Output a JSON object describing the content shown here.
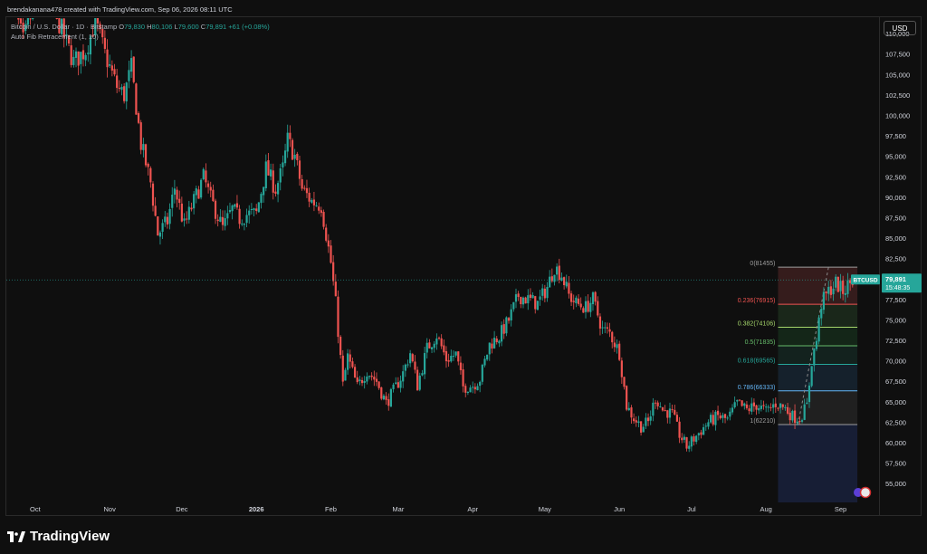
{
  "header": {
    "creator_line": "brendakanana478 created with TradingView.com, Sep 06, 2026 08:11 UTC"
  },
  "legend": {
    "symbol_line": "Bitcoin / U.S. Dollar · 1D · Bitstamp",
    "open_label": "O",
    "open_value": "79,830",
    "high_label": "H",
    "high_value": "80,106",
    "low_label": "L",
    "low_value": "79,600",
    "close_label": "C",
    "close_value": "79,891",
    "change_value": "+61 (+0.08%)",
    "indicator_line": "Auto Fib Retracement (1, 10)"
  },
  "price_axis": {
    "currency": "USD",
    "last_price_symbol": "BTCUSD",
    "last_price": "79,891",
    "countdown": "15:48:35"
  },
  "brand": {
    "name": "TradingView",
    "logo_icon": "tradingview-logo-icon"
  },
  "colors": {
    "up": "#26a69a",
    "down": "#ef5350",
    "background": "#0f0f0f"
  },
  "chart_data": {
    "type": "candlestick",
    "symbol": "BTCUSD",
    "exchange": "Bitstamp",
    "interval": "1D",
    "y_axis": {
      "min": 52700,
      "max": 112000,
      "ticks": [
        55000,
        57500,
        60000,
        62500,
        65000,
        67500,
        70000,
        72500,
        75000,
        77500,
        80000,
        82500,
        85000,
        87500,
        90000,
        92500,
        95000,
        97500,
        100000,
        102500,
        105000,
        107500,
        110000
      ],
      "tick_labels": [
        "55,000",
        "57,500",
        "60,000",
        "62,500",
        "65,000",
        "67,500",
        "70,000",
        "72,500",
        "75,000",
        "77,500",
        "80,000",
        "82,500",
        "85,000",
        "87,500",
        "90,000",
        "92,500",
        "95,000",
        "97,500",
        "100,000",
        "102,500",
        "105,000",
        "107,500",
        "110,000"
      ]
    },
    "x_axis": {
      "labels": [
        "Oct",
        "Nov",
        "Dec",
        "2026",
        "Feb",
        "Mar",
        "Apr",
        "May",
        "Jun",
        "Jul",
        "Aug",
        "Sep"
      ],
      "label_dates": [
        "2025-10-01",
        "2025-11-01",
        "2025-12-01",
        "2026-01-01",
        "2026-02-01",
        "2026-03-01",
        "2026-04-01",
        "2026-05-01",
        "2026-06-01",
        "2026-07-01",
        "2026-08-01",
        "2026-09-01"
      ],
      "start_date": "2025-09-19",
      "end_date": "2026-09-17"
    },
    "closes_path": [
      [
        "2025-09-20",
        115500
      ],
      [
        "2025-09-26",
        109000
      ],
      [
        "2025-10-01",
        114000
      ],
      [
        "2025-10-06",
        124000
      ],
      [
        "2025-10-10",
        112000
      ],
      [
        "2025-10-17",
        106500
      ],
      [
        "2025-10-22",
        108000
      ],
      [
        "2025-10-26",
        111500
      ],
      [
        "2025-10-30",
        107500
      ],
      [
        "2025-11-04",
        103500
      ],
      [
        "2025-11-07",
        102500
      ],
      [
        "2025-11-10",
        105800
      ],
      [
        "2025-11-14",
        96500
      ],
      [
        "2025-11-18",
        91800
      ],
      [
        "2025-11-21",
        85500
      ],
      [
        "2025-11-25",
        87000
      ],
      [
        "2025-11-28",
        91200
      ],
      [
        "2025-12-02",
        86500
      ],
      [
        "2025-12-06",
        89500
      ],
      [
        "2025-12-10",
        92400
      ],
      [
        "2025-12-13",
        89800
      ],
      [
        "2025-12-18",
        86200
      ],
      [
        "2025-12-22",
        88500
      ],
      [
        "2025-12-25",
        87400
      ],
      [
        "2025-12-28",
        87900
      ],
      [
        "2026-01-01",
        88000
      ],
      [
        "2026-01-05",
        93500
      ],
      [
        "2026-01-09",
        91000
      ],
      [
        "2026-01-12",
        93500
      ],
      [
        "2026-01-14",
        97000
      ],
      [
        "2026-01-17",
        95000
      ],
      [
        "2026-01-20",
        91000
      ],
      [
        "2026-01-24",
        89500
      ],
      [
        "2026-01-28",
        89000
      ],
      [
        "2026-02-01",
        82000
      ],
      [
        "2026-02-03",
        77000
      ],
      [
        "2026-02-06",
        67000
      ],
      [
        "2026-02-08",
        70500
      ],
      [
        "2026-02-12",
        66800
      ],
      [
        "2026-02-16",
        68800
      ],
      [
        "2026-02-20",
        67500
      ],
      [
        "2026-02-24",
        64800
      ],
      [
        "2026-02-28",
        66800
      ],
      [
        "2026-03-03",
        68500
      ],
      [
        "2026-03-06",
        71000
      ],
      [
        "2026-03-09",
        67000
      ],
      [
        "2026-03-13",
        71500
      ],
      [
        "2026-03-17",
        73200
      ],
      [
        "2026-03-21",
        70200
      ],
      [
        "2026-03-25",
        70800
      ],
      [
        "2026-03-28",
        66800
      ],
      [
        "2026-04-01",
        67000
      ],
      [
        "2026-04-04",
        67800
      ],
      [
        "2026-04-08",
        72000
      ],
      [
        "2026-04-12",
        73000
      ],
      [
        "2026-04-16",
        75000
      ],
      [
        "2026-04-20",
        78000
      ],
      [
        "2026-04-24",
        77500
      ],
      [
        "2026-04-28",
        77000
      ],
      [
        "2026-05-02",
        79000
      ],
      [
        "2026-05-05",
        81500
      ],
      [
        "2026-05-08",
        80500
      ],
      [
        "2026-05-11",
        78000
      ],
      [
        "2026-05-14",
        77000
      ],
      [
        "2026-05-18",
        76500
      ],
      [
        "2026-05-21",
        77500
      ],
      [
        "2026-05-25",
        73800
      ],
      [
        "2026-05-28",
        73400
      ],
      [
        "2026-06-01",
        71000
      ],
      [
        "2026-06-04",
        64500
      ],
      [
        "2026-06-07",
        63000
      ],
      [
        "2026-06-10",
        62000
      ],
      [
        "2026-06-13",
        62500
      ],
      [
        "2026-06-16",
        65500
      ],
      [
        "2026-06-19",
        64000
      ],
      [
        "2026-06-23",
        63500
      ],
      [
        "2026-06-26",
        61000
      ],
      [
        "2026-06-29",
        59500
      ],
      [
        "2026-07-02",
        60500
      ],
      [
        "2026-07-05",
        61500
      ],
      [
        "2026-07-08",
        62500
      ],
      [
        "2026-07-12",
        63200
      ],
      [
        "2026-07-16",
        62800
      ],
      [
        "2026-07-20",
        64800
      ],
      [
        "2026-07-24",
        64000
      ],
      [
        "2026-07-28",
        64600
      ],
      [
        "2026-08-01",
        63800
      ],
      [
        "2026-08-05",
        64800
      ],
      [
        "2026-08-09",
        64200
      ],
      [
        "2026-08-12",
        63200
      ],
      [
        "2026-08-15",
        63000
      ],
      [
        "2026-08-18",
        64500
      ],
      [
        "2026-08-20",
        70000
      ],
      [
        "2026-08-22",
        72500
      ],
      [
        "2026-08-24",
        77000
      ],
      [
        "2026-08-27",
        78500
      ],
      [
        "2026-08-30",
        79500
      ],
      [
        "2026-09-02",
        78500
      ],
      [
        "2026-09-04",
        79200
      ],
      [
        "2026-09-06",
        79891
      ]
    ],
    "fib_retracement": {
      "name": "Auto Fib Retracement (1, 10)",
      "start_date": "2026-08-06",
      "end_date": "2026-09-08",
      "levels": [
        {
          "ratio": "0",
          "price": 81455,
          "label": "0(81455)",
          "color": "#9e9e9e",
          "fill": "#3a1e1e"
        },
        {
          "ratio": "0.236",
          "price": 76915,
          "label": "0.236(76915)",
          "color": "#ef5350",
          "fill": "#1c2a1c"
        },
        {
          "ratio": "0.382",
          "price": 74106,
          "label": "0.382(74106)",
          "color": "#a5d66b",
          "fill": "#15291a"
        },
        {
          "ratio": "0.5",
          "price": 71835,
          "label": "0.5(71835)",
          "color": "#66bb6a",
          "fill": "#142520"
        },
        {
          "ratio": "0.618",
          "price": 69565,
          "label": "0.618(69565)",
          "color": "#26a69a",
          "fill": "#162330"
        },
        {
          "ratio": "0.786",
          "price": 66333,
          "label": "0.786(66333)",
          "color": "#64b5f6",
          "fill": "#222222"
        },
        {
          "ratio": "1",
          "price": 62210,
          "label": "1(62210)",
          "color": "#9e9e9e",
          "fill": "#18203a"
        }
      ],
      "extension_bottom": 52700
    },
    "last_price": 79891
  }
}
